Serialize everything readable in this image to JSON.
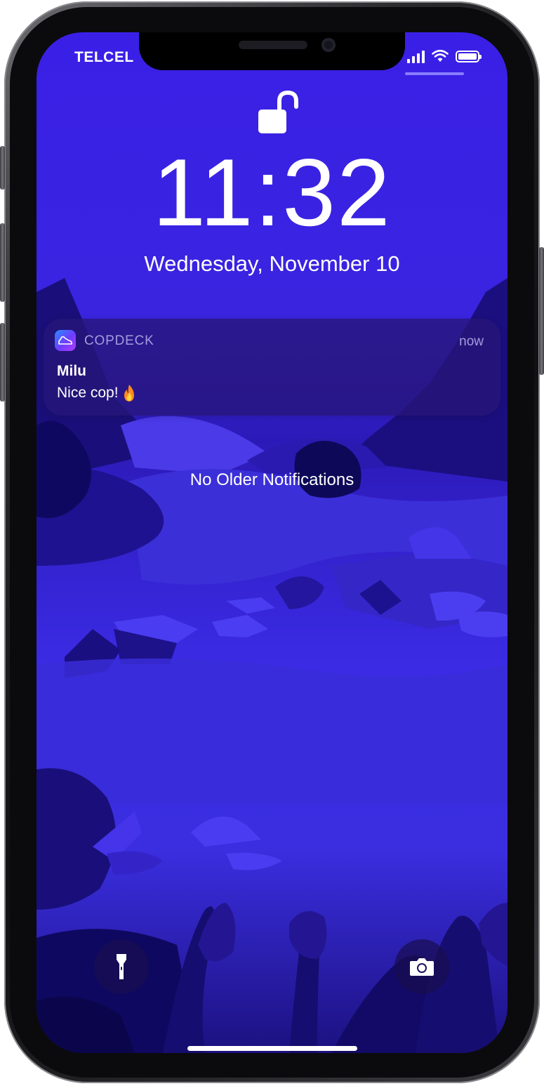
{
  "status_bar": {
    "carrier": "TELCEL",
    "signal_icon": "cellular-signal-icon",
    "wifi_icon": "wifi-icon",
    "battery_icon": "battery-icon"
  },
  "lock_screen": {
    "lock_icon": "unlocked-padlock-icon",
    "time": "11:32",
    "date": "Wednesday, November 10"
  },
  "notification": {
    "app_icon": "copdeck-app-icon",
    "app_name": "COPDECK",
    "time": "now",
    "title": "Milu",
    "body": "Nice cop!",
    "emoji_icon": "fire-emoji-icon"
  },
  "no_older_label": "No Older Notifications",
  "quick_actions": {
    "left_icon": "flashlight-icon",
    "right_icon": "camera-icon"
  },
  "colors": {
    "wallpaper_primary": "#3a24e0",
    "notification_bg": "#261678",
    "accent": "#8a7dff"
  }
}
